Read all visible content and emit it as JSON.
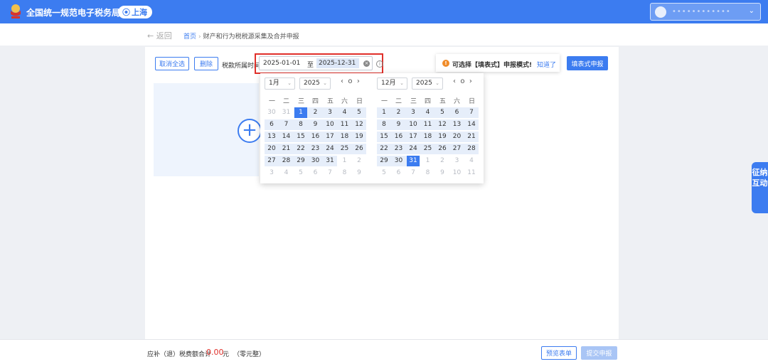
{
  "header": {
    "site_title": "全国统一规范电子税务局",
    "region": "上海",
    "user_name": "••••••••••••"
  },
  "breadcrumb": {
    "back_label": "← 返回",
    "home": "首页",
    "separator": "›",
    "current": "财产和行为税税源采集及合并申报"
  },
  "toolbar": {
    "cancel_all": "取消全选",
    "delete": "删除",
    "period_label": "税款所属时间",
    "start_date": "2025-01-01",
    "to": "至",
    "end_date": "2025-12-31",
    "fill_mode_button": "填表式申报"
  },
  "notice": {
    "text": "可选择【填表式】申报模式!",
    "link": "知道了"
  },
  "side_tab": {
    "label": "征纳互动"
  },
  "calendar": {
    "weekdays": [
      "一",
      "二",
      "三",
      "四",
      "五",
      "六",
      "日"
    ],
    "left": {
      "month": "1月",
      "year": "2025",
      "weeks": [
        [
          "30",
          "31",
          "1",
          "2",
          "3",
          "4",
          "5"
        ],
        [
          "6",
          "7",
          "8",
          "9",
          "10",
          "11",
          "12"
        ],
        [
          "13",
          "14",
          "15",
          "16",
          "17",
          "18",
          "19"
        ],
        [
          "20",
          "21",
          "22",
          "23",
          "24",
          "25",
          "26"
        ],
        [
          "27",
          "28",
          "29",
          "30",
          "31",
          "1",
          "2"
        ],
        [
          "3",
          "4",
          "5",
          "6",
          "7",
          "8",
          "9"
        ]
      ],
      "muted": [
        [
          0,
          0
        ],
        [
          0,
          1
        ],
        [
          4,
          5
        ],
        [
          4,
          6
        ],
        [
          5,
          0
        ],
        [
          5,
          1
        ],
        [
          5,
          2
        ],
        [
          5,
          3
        ],
        [
          5,
          4
        ],
        [
          5,
          5
        ],
        [
          5,
          6
        ]
      ],
      "selected": [
        0,
        2
      ]
    },
    "right": {
      "month": "12月",
      "year": "2025",
      "weeks": [
        [
          "1",
          "2",
          "3",
          "4",
          "5",
          "6",
          "7"
        ],
        [
          "8",
          "9",
          "10",
          "11",
          "12",
          "13",
          "14"
        ],
        [
          "15",
          "16",
          "17",
          "18",
          "19",
          "20",
          "21"
        ],
        [
          "22",
          "23",
          "24",
          "25",
          "26",
          "27",
          "28"
        ],
        [
          "29",
          "30",
          "31",
          "1",
          "2",
          "3",
          "4"
        ],
        [
          "5",
          "6",
          "7",
          "8",
          "9",
          "10",
          "11"
        ]
      ],
      "muted": [
        [
          4,
          3
        ],
        [
          4,
          4
        ],
        [
          4,
          5
        ],
        [
          4,
          6
        ],
        [
          5,
          0
        ],
        [
          5,
          1
        ],
        [
          5,
          2
        ],
        [
          5,
          3
        ],
        [
          5,
          4
        ],
        [
          5,
          5
        ],
        [
          5,
          6
        ]
      ],
      "selected": [
        4,
        2
      ]
    },
    "nav": {
      "prev": "‹",
      "today": "o",
      "next": "›"
    }
  },
  "footer": {
    "label": "应补（退）税费额合计",
    "amount": "0.00",
    "unit": "元",
    "amount_words": "（零元整）",
    "preview_button": "预览表单",
    "submit_button": "提交申报"
  },
  "colors": {
    "brand": "#3c7cf0",
    "highlight": "#e0302a",
    "warning": "#f08c2a"
  }
}
